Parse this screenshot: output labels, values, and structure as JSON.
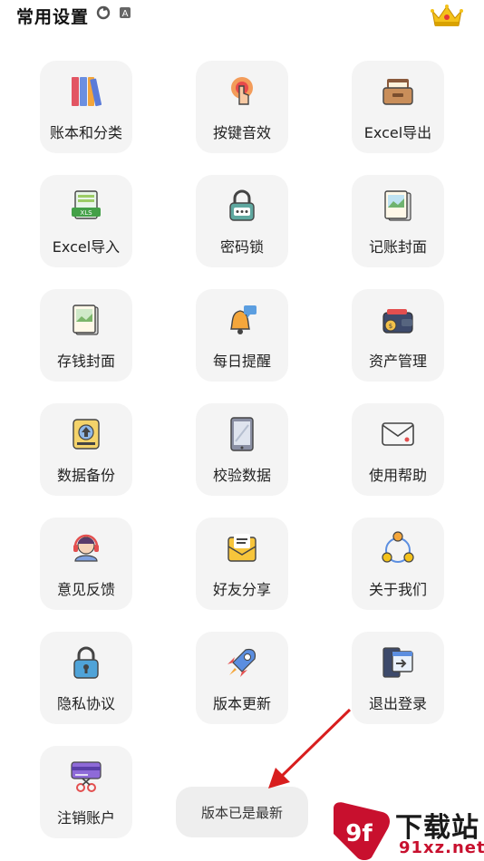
{
  "header": {
    "title": "常用设置"
  },
  "status_icons": [
    "camera-icon",
    "refresh-icon",
    "notification-a-icon"
  ],
  "items": [
    {
      "label": "账本和分类",
      "icon": "books-icon"
    },
    {
      "label": "按键音效",
      "icon": "tap-button-icon"
    },
    {
      "label": "Excel导出",
      "icon": "drawer-export-icon"
    },
    {
      "label": "Excel导入",
      "icon": "xls-import-icon"
    },
    {
      "label": "密码锁",
      "icon": "padlock-keypad-icon"
    },
    {
      "label": "记账封面",
      "icon": "picture-frame-icon"
    },
    {
      "label": "存钱封面",
      "icon": "photo-cover-icon"
    },
    {
      "label": "每日提醒",
      "icon": "bell-reminder-icon"
    },
    {
      "label": "资产管理",
      "icon": "wallet-icon"
    },
    {
      "label": "数据备份",
      "icon": "backup-upload-icon"
    },
    {
      "label": "校验数据",
      "icon": "tablet-icon"
    },
    {
      "label": "使用帮助",
      "icon": "envelope-help-icon"
    },
    {
      "label": "意见反馈",
      "icon": "headset-support-icon"
    },
    {
      "label": "好友分享",
      "icon": "share-mail-icon"
    },
    {
      "label": "关于我们",
      "icon": "network-people-icon"
    },
    {
      "label": "隐私协议",
      "icon": "privacy-lock-icon"
    },
    {
      "label": "版本更新",
      "icon": "rocket-icon"
    },
    {
      "label": "退出登录",
      "icon": "logout-door-icon"
    },
    {
      "label": "注销账户",
      "icon": "card-cut-icon"
    }
  ],
  "toast": {
    "text": "版本已是最新"
  },
  "watermark": {
    "title": "下载站",
    "url": "91xz.net",
    "badge": "9f"
  },
  "colors": {
    "card_bg": "#f4f4f4",
    "arrow": "#d81e1e",
    "watermark_red": "#c8102e"
  }
}
